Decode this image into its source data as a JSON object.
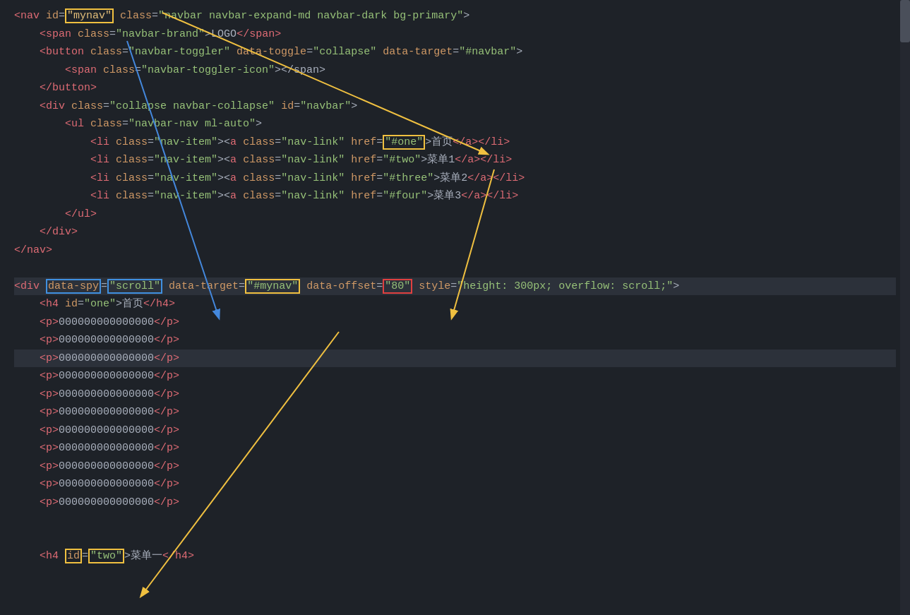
{
  "editor": {
    "background": "#1e2228",
    "lines": [
      {
        "id": "line1",
        "parts": [
          {
            "type": "tag",
            "text": "<nav "
          },
          {
            "type": "attr-name",
            "text": "id"
          },
          {
            "type": "equals",
            "text": "="
          },
          {
            "type": "attr-value-id",
            "text": "\"mynav\""
          },
          {
            "type": "bracket",
            "text": " "
          },
          {
            "type": "attr-name",
            "text": "class"
          },
          {
            "type": "equals",
            "text": "="
          },
          {
            "type": "attr-value",
            "text": "\"navbar navbar-expand-md navbar-dark bg-primary\""
          },
          {
            "type": "bracket",
            "text": ">"
          }
        ],
        "indent": 0
      }
    ]
  },
  "annotations": {
    "boxes": [
      {
        "id": "box-mynav",
        "type": "yellow",
        "label": "id=\"mynav\""
      },
      {
        "id": "box-href-one",
        "type": "yellow",
        "label": "href=\"#one\""
      },
      {
        "id": "box-data-spy",
        "type": "blue",
        "label": "data-spy=\"scroll\""
      },
      {
        "id": "box-data-target",
        "type": "yellow",
        "label": "data-target=\"#mynav\""
      },
      {
        "id": "box-data-offset",
        "type": "red",
        "label": "data-offset=\"80\""
      },
      {
        "id": "box-id-two",
        "type": "yellow",
        "label": "id=\"two\""
      }
    ]
  }
}
